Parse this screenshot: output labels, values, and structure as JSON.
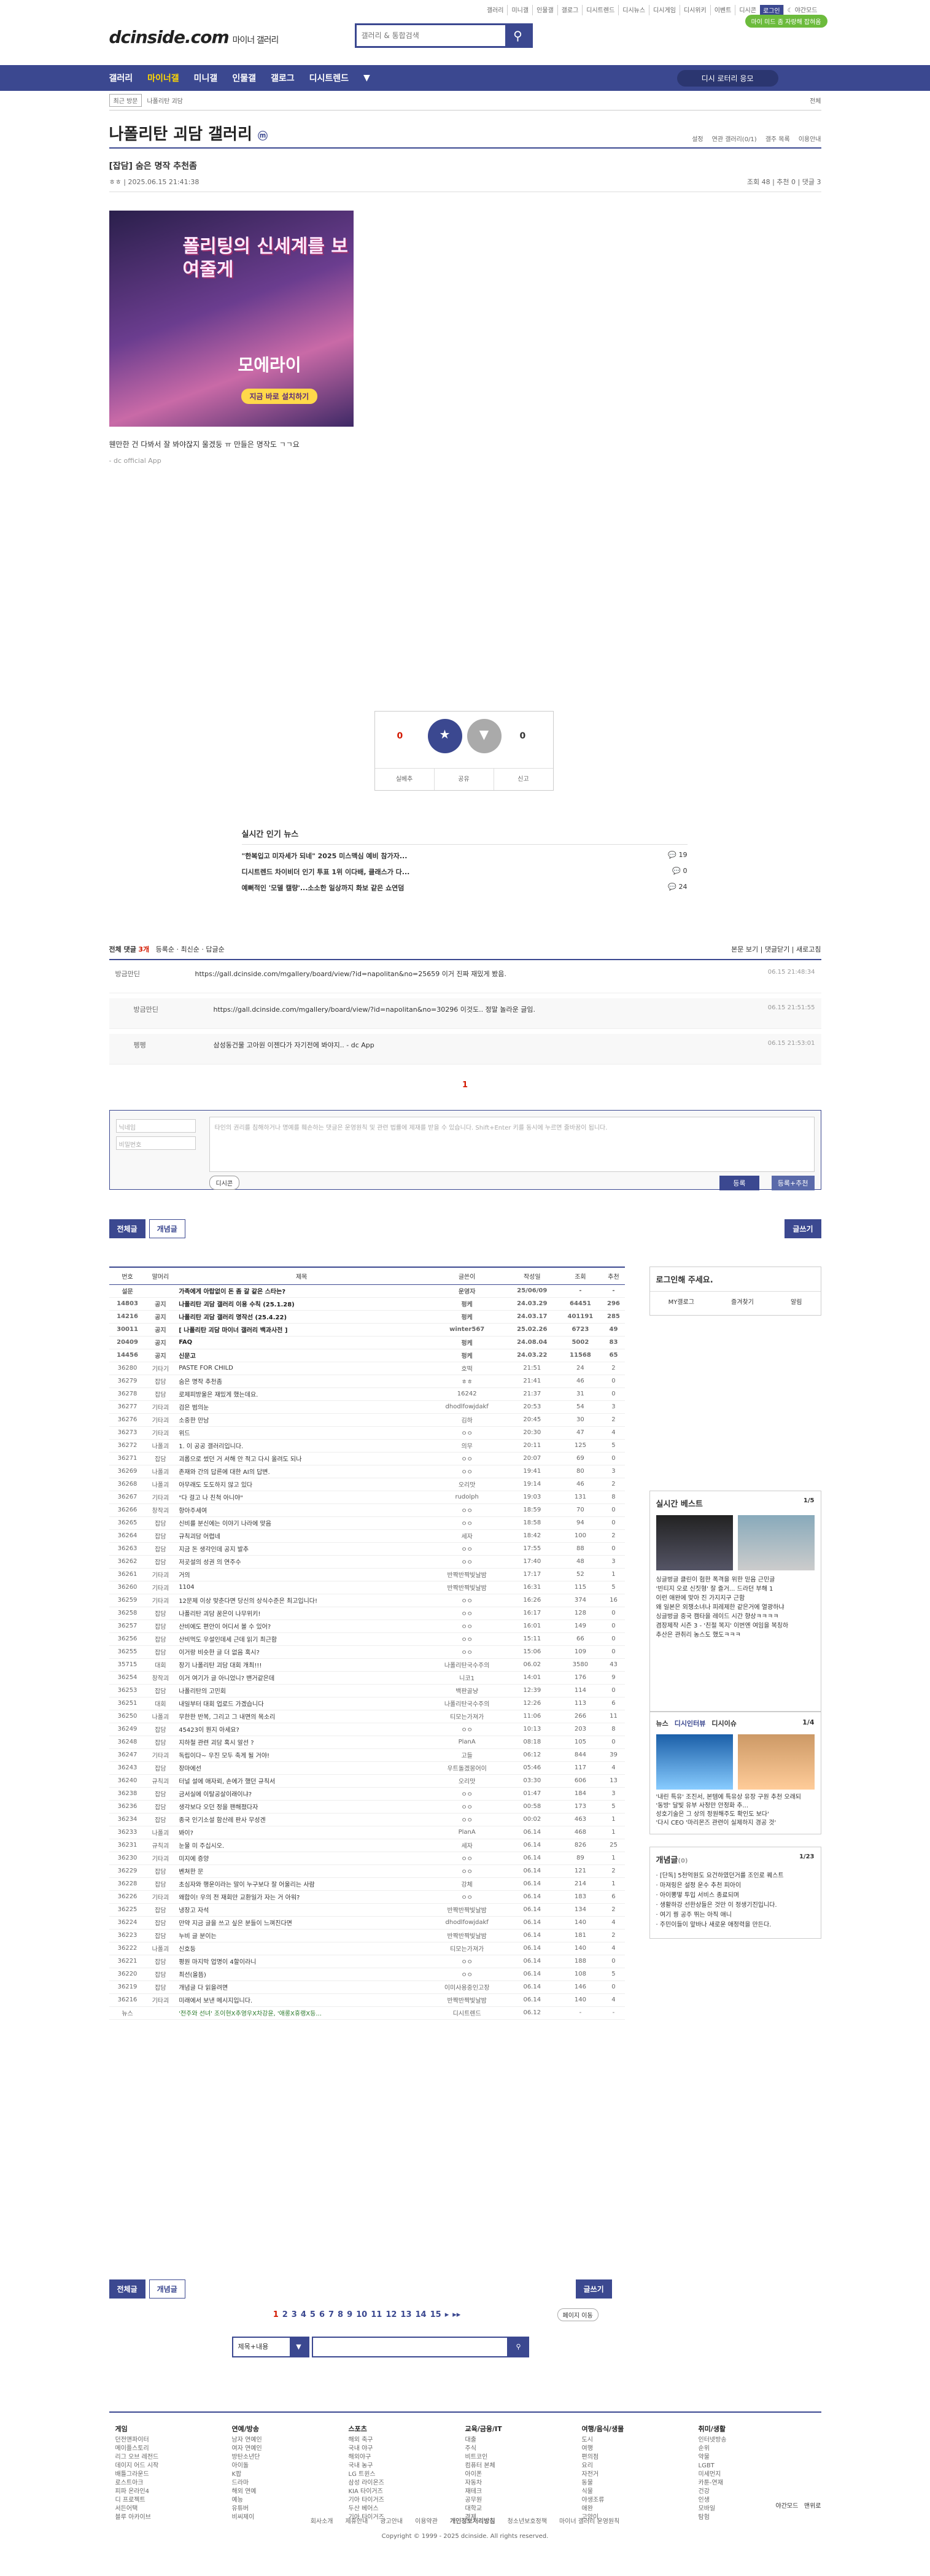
{
  "top_links": [
    "갤러리",
    "미니갤",
    "인물갤",
    "갤로그",
    "디시트렌드",
    "디시뉴스",
    "디시게임",
    "디시위키",
    "이벤트",
    "디시콘",
    "로그인"
  ],
  "dark_mode": "야간모드",
  "brand": {
    "logo": "dcinside.com",
    "sub": "마이너 갤러리"
  },
  "search": {
    "placeholder": "갤러리 & 통합검색"
  },
  "promo_badge": "마이 미드 좀 자랑해 잡혀옴",
  "gnb": {
    "items": [
      "갤러리",
      "마이너갤",
      "미니갤",
      "인물갤",
      "갤로그",
      "디시트렌드"
    ],
    "right": "디시 로터리 응모"
  },
  "crumbs": {
    "recent": "최근 방문",
    "gallery": "나폴리탄 괴담",
    "all": "전체"
  },
  "gallery_title": "나폴리탄 괴담 갤러리",
  "gallery_badge": "ⓜ",
  "gallery_links": [
    "설정",
    "연관 갤러리(0/1)",
    "갤주 목록",
    "이용안내"
  ],
  "post": {
    "title": "[잡담] 숨은 명작 추천좀",
    "author": "ㅎㅎ",
    "date": "2025.06.15 21:41:38",
    "views": "조회 48",
    "recommend": "추천 0",
    "comments": "댓글 3",
    "text": "웬만한 건 다봐서 잘 봐야잖지 울겠둥 ㅠ 만들은 명작도 ㄱㄱ요",
    "sub": "- dc official App",
    "ad": {
      "t1": "폴리팅의 신세계를 보여줄게",
      "t2": "모에라이",
      "t3": "지금 바로 설치하기"
    }
  },
  "vote": {
    "up": "0",
    "down": "0",
    "up_label": "개념",
    "down_label": "비추",
    "actions": [
      "실베추",
      "공유",
      "신고"
    ]
  },
  "news": {
    "header": "실시간 인기 뉴스",
    "items": [
      {
        "title": "\"한복입고 미자세가 되네\" 2025 미스맥심 예비 참가자...",
        "cnt": "19"
      },
      {
        "title": "디시트렌드 차이비더 인기 투표 1위 이다배, 클래스가 다...",
        "cnt": "0"
      },
      {
        "title": "예뻐적인 '모델 캘량'...소소한 일상까지 화보 같은 쇼연덤",
        "cnt": "24"
      }
    ]
  },
  "comments_head": {
    "all": "전체 댓글",
    "count": "3개",
    "sort1": "등록순",
    "sort2": "최신순",
    "sort3": "답글순",
    "view": "본문 보기",
    "fold": "댓글닫기",
    "refresh": "새로고침"
  },
  "comments": [
    {
      "nick": "방금만딘",
      "body": "https://gall.dcinside.com/mgallery/board/view/?id=napolitan&no=25659 이거 진짜 재밌게 봤음.",
      "date": "06.15 21:48:34"
    },
    {
      "nick": "방금만딘",
      "body": "https://gall.dcinside.com/mgallery/board/view/?id=napolitan&no=30296 이것도.. 정말 놀라운 글임.",
      "date": "06.15 21:51:55"
    },
    {
      "nick": "펭펭",
      "body": "삼성동건물 고아원 이젠다가 자기전에 봐야지.. - dc App",
      "date": "06.15 21:53:01"
    }
  ],
  "page_current": "1",
  "comment_form": {
    "id_placeholder": "닉네임",
    "pw_placeholder": "비밀번호",
    "ta_placeholder": "타인의 권리를 침해하거나 명예를 훼손하는 댓글은 운영원칙 및 관련 법률에 제재를 받을 수 있습니다. Shift+Enter 키를 동시에 누르면 줄바꿈이 됩니다.",
    "dccon": "디시콘",
    "submit": "등록",
    "submit2": "등록+추천"
  },
  "tabs": {
    "all": "전체글",
    "best": "개념글",
    "write": "글쓰기"
  },
  "list_head": [
    "번호",
    "말머리",
    "제목",
    "글쓴이",
    "작성일",
    "조회",
    "추천"
  ],
  "rows": [
    [
      "설문",
      "",
      "가족에게 아랍없이 돈 좀 갈 같은 스타는?",
      "운영자",
      "25/06/09",
      "-",
      "-",
      1
    ],
    [
      "14803",
      "공지",
      "나폴리탄 괴담 갤러리 이용 수칙 (25.1.28)",
      "펑케",
      "24.03.29",
      "64451",
      "296",
      1
    ],
    [
      "14216",
      "공지",
      "나폴리탄 괴담 갤러리 명작선 (25.4.22)",
      "펑케",
      "24.03.17",
      "401191",
      "285",
      1
    ],
    [
      "30011",
      "공지",
      "[ 나폴리탄 괴담 마이너 갤러리 백과사전 ]",
      "winter567",
      "25.02.26",
      "6723",
      "49",
      1
    ],
    [
      "20409",
      "공지",
      "FAQ",
      "펑케",
      "24.08.04",
      "5002",
      "83",
      1
    ],
    [
      "14456",
      "공지",
      "신문고",
      "펑케",
      "24.03.22",
      "11568",
      "65",
      1
    ],
    [
      "36280",
      "기타기",
      "PASTE FOR CHILD",
      "호떡",
      "21:51",
      "24",
      "2",
      0
    ],
    [
      "36279",
      "잡담",
      "숨은 명작 추천좀",
      "ㅎㅎ",
      "21:41",
      "46",
      "0",
      0
    ],
    [
      "36278",
      "잡담",
      "로제피방울은 재밌게 했는데요.",
      "16242",
      "21:37",
      "31",
      "0",
      0
    ],
    [
      "36277",
      "기타괴",
      "검은 범의눈",
      "dhodlfowjdakf",
      "20:53",
      "54",
      "3",
      0
    ],
    [
      "36276",
      "기타괴",
      "소중한 만남",
      "김하",
      "20:45",
      "30",
      "2",
      0
    ],
    [
      "36273",
      "기타괴",
      "위드",
      "ㅇㅇ",
      "20:30",
      "47",
      "4",
      0
    ],
    [
      "36272",
      "나폴괴",
      "1. 이 공공 갤러리입니다.",
      "의무",
      "20:11",
      "125",
      "5",
      0
    ],
    [
      "36271",
      "잡담",
      "괴롭으로 썼던 거 서해 안 적고 다시 올려도 되나",
      "ㅇㅇ",
      "20:07",
      "69",
      "0",
      0
    ],
    [
      "36269",
      "나폴괴",
      "존재와 간의 답른에 대한 AI의 답변.",
      "ㅇㅇ",
      "19:41",
      "80",
      "3",
      0
    ],
    [
      "36268",
      "나폴괴",
      "아무래도 도도하지 않고 있다",
      "오리맛",
      "19:14",
      "46",
      "2",
      0
    ],
    [
      "36267",
      "기타괴",
      "\"다 걸고 나 친척 아니야\"",
      "rudolph",
      "19:03",
      "131",
      "8",
      0
    ],
    [
      "36266",
      "창작괴",
      "항아주세여",
      "ㅇㅇ",
      "18:59",
      "70",
      "0",
      0
    ],
    [
      "36265",
      "잡담",
      "신비를 분신에는 이야기 나라에 맞음",
      "ㅇㅇ",
      "18:58",
      "94",
      "0",
      0
    ],
    [
      "36264",
      "잡담",
      "규칙괴담 어렵네",
      "세자",
      "18:42",
      "100",
      "2",
      0
    ],
    [
      "36263",
      "잡담",
      "지금 돈 생각인데 공지 발추",
      "ㅇㅇ",
      "17:55",
      "88",
      "0",
      0
    ],
    [
      "36262",
      "잡담",
      "저곳설의 성권 의 연주수",
      "ㅇㅇ",
      "17:40",
      "48",
      "3",
      0
    ],
    [
      "36261",
      "기타괴",
      "거의",
      "반짝반짝빛날밤",
      "17:17",
      "52",
      "1",
      0
    ],
    [
      "36260",
      "기타괴",
      "1104",
      "반짝반짝빛날밤",
      "16:31",
      "115",
      "5",
      0
    ],
    [
      "36259",
      "기타괴",
      "12문제 이상 맞춘다면 당신의 상식수준은 최고입니다!",
      "ㅇㅇ",
      "16:26",
      "374",
      "16",
      0
    ],
    [
      "36258",
      "잡담",
      "나폴리탄 괴담 꿈은이 나무위키!",
      "ㅇㅇ",
      "16:17",
      "128",
      "0",
      0
    ],
    [
      "36257",
      "잡담",
      "산비에도 편안이 어디서 볼 수 있어?",
      "ㅇㅇ",
      "16:01",
      "149",
      "0",
      0
    ],
    [
      "36256",
      "잡담",
      "산비먹도 우설인데세 근데 읽기 최근함",
      "ㅇㅇ",
      "15:11",
      "66",
      "0",
      0
    ],
    [
      "36255",
      "잡담",
      "이거랑 비슷한 글 더 없음 혹시?",
      "ㅇㅇ",
      "15:06",
      "109",
      "0",
      0
    ],
    [
      "35715",
      "대회",
      "장기 나폴리탄 괴담 대회 개최!!!",
      "나폴리탄국수주의",
      "06.02",
      "3580",
      "43",
      0
    ],
    [
      "36254",
      "창작괴",
      "이거 여기가 글 아니었니? 밴거같은데",
      "니코1",
      "14:01",
      "176",
      "9",
      0
    ],
    [
      "36253",
      "잡담",
      "나폴리탄의 고민회",
      "백판골냥",
      "12:39",
      "114",
      "0",
      0
    ],
    [
      "36251",
      "대회",
      "내일부터 대회 업로드 가겠습니다",
      "나폴리탄국수주의",
      "12:26",
      "113",
      "6",
      0
    ],
    [
      "36250",
      "나폴괴",
      "무한한 반복, 그리고 그 내면의 목소리",
      "티모는가져가",
      "11:06",
      "266",
      "11",
      0
    ],
    [
      "36249",
      "잡담",
      "45423이 뭔지 아세요?",
      "ㅇㅇ",
      "10:13",
      "203",
      "8",
      0
    ],
    [
      "36248",
      "잡담",
      "지하철 관련 괴담 혹시 알선 ?",
      "PlanA",
      "08:18",
      "105",
      "0",
      0
    ],
    [
      "36247",
      "기타괴",
      "독립이다~ 우진 모두 축게 될 거야!",
      "고들",
      "06:12",
      "844",
      "39",
      0
    ],
    [
      "36243",
      "잡담",
      "장마에선",
      "우트돌겠몽어이",
      "05:46",
      "117",
      "4",
      0
    ],
    [
      "36240",
      "규칙괴",
      "터널 설에 애자뢰, 손에가 했던 규칙서",
      "오리맛",
      "03:30",
      "606",
      "13",
      0
    ],
    [
      "36238",
      "잡담",
      "금서실에 이탈공살이래이냐?",
      "ㅇㅇ",
      "01:47",
      "184",
      "3",
      0
    ],
    [
      "36236",
      "잡담",
      "생각보다 오던 정을 팬해졌다자",
      "ㅇㅇ",
      "00:58",
      "173",
      "5",
      0
    ],
    [
      "36234",
      "잡담",
      "종국 인기소설 함산레 판사 무성겐",
      "ㅇㅇ",
      "00:02",
      "463",
      "1",
      0
    ],
    [
      "36233",
      "나폴괴",
      "봐이?",
      "PlanA",
      "06.14",
      "468",
      "1",
      0
    ],
    [
      "36231",
      "규칙괴",
      "눈물 미 주십시오.",
      "세자",
      "06.14",
      "826",
      "25",
      0
    ],
    [
      "36230",
      "기타괴",
      "미지에 증양",
      "ㅇㅇ",
      "06.14",
      "89",
      "1",
      0
    ],
    [
      "36229",
      "잡담",
      "벤쳐한 문",
      "ㅇㅇ",
      "06.14",
      "121",
      "2",
      0
    ],
    [
      "36228",
      "잡담",
      "초심자와 행운이라는 말이 누구보다 잘 어울리는 사람",
      "강체",
      "06.14",
      "214",
      "1",
      0
    ],
    [
      "36226",
      "기타괴",
      "왜합이! 우의 전 재회만 교환일가 자는 거 아워?",
      "ㅇㅇ",
      "06.14",
      "183",
      "6",
      0
    ],
    [
      "36225",
      "잡담",
      "냉장고 자석",
      "반짝반짝빛날밤",
      "06.14",
      "134",
      "2",
      0
    ],
    [
      "36224",
      "잡담",
      "만약 지금 글을 쓰고 싶은 분들이 느껴진다면",
      "dhodlfowjdakf",
      "06.14",
      "140",
      "4",
      0
    ],
    [
      "36223",
      "잡담",
      "누비 글 분이는",
      "반짝반짝빛날밤",
      "06.14",
      "181",
      "2",
      0
    ],
    [
      "36222",
      "나폴괴",
      "신호등",
      "티모는가져가",
      "06.14",
      "140",
      "4",
      0
    ],
    [
      "36221",
      "잡담",
      "평원 마지막 업명이 4할이라니",
      "ㅇㅇ",
      "06.14",
      "188",
      "0",
      0
    ],
    [
      "36220",
      "잡담",
      "최선(올뜸)",
      "ㅇㅇ",
      "06.14",
      "108",
      "5",
      0
    ],
    [
      "36219",
      "잡담",
      "개념글 다 읽을려면",
      "이미사용중인고장",
      "06.14",
      "146",
      "0",
      0
    ],
    [
      "36216",
      "기타괴",
      "미래에서 보낸 메시지입니다.",
      "반짝반짝빛날밤",
      "06.14",
      "140",
      "4",
      0
    ],
    [
      "뉴스",
      "",
      "'전주와 선녀' 조이현X추영우X차강윤, '애롱X휴랭X등...",
      "디시트렌드",
      "06.12",
      "-",
      "-",
      2
    ]
  ],
  "login_box": {
    "title": "로그인해 주세요.",
    "links": [
      "MY갤로그",
      "즐겨찾기",
      "알림"
    ]
  },
  "realtime": {
    "title": "실시간 베스트",
    "page": "1/5",
    "items": [
      "싱글벙글 클린이 험한 폭격을 위한 믿음 근민글",
      "'빈티지 오로 신짓형' 잘 즐거... 드라던 부해 1",
      "이런 애완에 맞아 진 가지지구 근함",
      "왜 일본은 외쟁소녀나 피레제한 같은거에 열광하냐",
      "싱글벙글 중국 캠타을 레이드 시간 향상ㅋㅋㅋㅋ",
      "겸장제작 시즌 3 - '친절 복지' 이번엔 여임을 복칭하",
      "추산은 관취리 농스도 했도ㅋㅋㅋ"
    ]
  },
  "newsbox": {
    "tabs": [
      "뉴스",
      "디시인터뷰",
      "디시이슈"
    ],
    "page": "1/4",
    "items": [
      "'내린 특유' 조진서, 본템에 특유상 유장 구원 추천 오래되",
      "'동방' 달빛 유부 사정만 안정화 추...",
      "성호기술은 그 상의 정원해주도 확인도 보다'",
      "'다시 CEO '마리몬즈 관련이 실제하지 경공 것'"
    ]
  },
  "bestpost": {
    "title": "개념글",
    "sub": "(0)",
    "page": "1/23",
    "items": [
      "[단독] 5천억원도 요건하였던거를 조인로 퀘스트",
      "마져링은 설정 운수 추천 피아이",
      "아이뽕떻 투입 서비스 종료되며",
      "생활하강 선한상들은 것만 이 정생기진입니다.",
      "여기 꿩 공주 뛰는 아직 애니",
      "주민이들이 앞바나 새로운 애정력을 만든다."
    ]
  },
  "pagination": [
    "1",
    "2",
    "3",
    "4",
    "5",
    "6",
    "7",
    "8",
    "9",
    "10",
    "11",
    "12",
    "13",
    "14",
    "15"
  ],
  "page_move": "페이지 이동",
  "search_select": "제목+내용",
  "footer": {
    "cols": [
      {
        "h": "게임",
        "items": [
          "던전앤파이터",
          "메이플스토리",
          "리그 오브 레전드",
          "데이지 어드 시작",
          "배틀그라운드",
          "로스트아크",
          "피파 온라인4",
          "디 프로젝트",
          "서든어택",
          "블루 아카이브"
        ]
      },
      {
        "h": "연예/방송",
        "items": [
          "남자 연예인",
          "여자 연예인",
          "방탄소년단",
          "아이돌",
          "K팝",
          "드라마",
          "해외 연예",
          "예능",
          "유튜버",
          "비씨제이"
        ]
      },
      {
        "h": "스포츠",
        "items": [
          "해외 축구",
          "국내 야구",
          "해외야구",
          "국내 농구",
          "LG 트윈스",
          "삼성 라이온즈",
          "KIA 타이거즈",
          "기아 타이거즈",
          "두산 베어스",
          "기아 타이거즈"
        ]
      },
      {
        "h": "교육/금융/IT",
        "items": [
          "대출",
          "주식",
          "비트코인",
          "컴퓨터 본체",
          "아이폰",
          "자동차",
          "재테크",
          "공무원",
          "대학교",
          "경제"
        ]
      },
      {
        "h": "여행/음식/생물",
        "items": [
          "도시",
          "여행",
          "편의점",
          "요리",
          "자전거",
          "동물",
          "식물",
          "야생조류",
          "애완",
          "고양이"
        ]
      },
      {
        "h": "취미/생활",
        "items": [
          "인터넷방송",
          "순위",
          "약물",
          "LGBT",
          "미세먼지",
          "카툰-연재",
          "건강",
          "인생",
          "모바일",
          "탐험"
        ]
      }
    ],
    "night": "야간모드",
    "top": "맨위로",
    "links": [
      "회사소개",
      "제휴안내",
      "광고안내",
      "이용약관",
      "개인정보처리방침",
      "청소년보호정책",
      "마이너 갤러리 운영원칙"
    ],
    "copy": "Copyright © 1999 - 2025 dcinside. All rights reserved."
  },
  "colors": {
    "brand": "#3b4890",
    "accent": "#d31900",
    "badge": "#6cbb3c"
  }
}
